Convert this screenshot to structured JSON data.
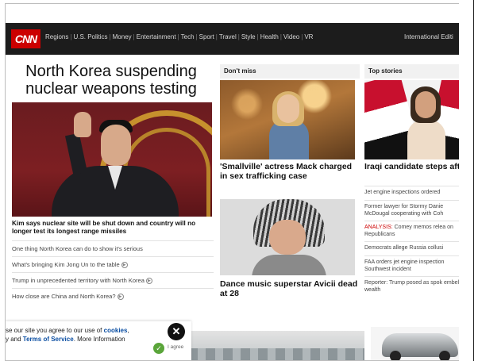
{
  "nav": {
    "logo": "CNN",
    "links": [
      "Regions",
      "U.S. Politics",
      "Money",
      "Entertainment",
      "Tech",
      "Sport",
      "Travel",
      "Style",
      "Health",
      "Video",
      "VR"
    ],
    "edition": "International Editi"
  },
  "lead": {
    "headline": "North Korea suspending nuclear weapons testing",
    "caption": "Kim says nuclear site will be shut down and country will no longer test its longest range missiles",
    "related": [
      {
        "text": "One thing North Korea can do to show it's serious",
        "video": false
      },
      {
        "text": "What's bringing Kim Jong Un to the table",
        "video": true
      },
      {
        "text": "Trump in unprecedented territory with North Korea",
        "video": true
      },
      {
        "text": "How close are China and North Korea?",
        "video": true
      }
    ]
  },
  "dont_miss": {
    "label": "Don't miss",
    "story1": "'Smallville' actress Mack charged in sex trafficking case",
    "story2": "Dance music superstar Avicii dead at 28"
  },
  "top_stories": {
    "label": "Top stories",
    "lead_title": "Iraqi candidate steps after sex tape allegati",
    "items": [
      {
        "prefix": "",
        "text": "Jet engine inspections ordered"
      },
      {
        "prefix": "",
        "text": "Former lawyer for Stormy Danie McDougal cooperating with Coh"
      },
      {
        "prefix": "ANALYSIS:",
        "text": " Comey memos relea on Republicans"
      },
      {
        "prefix": "",
        "text": "Democrats allege Russia collusi"
      },
      {
        "prefix": "",
        "text": "FAA orders jet engine inspection Southwest incident"
      },
      {
        "prefix": "",
        "text": "Reporter: Trump posed as spok embellish wealth"
      }
    ]
  },
  "cookie": {
    "line1_prefix": "se our site you agree to our use of ",
    "cookies_link": "cookies",
    "line1_suffix": ",",
    "line2_prefix": "y and ",
    "terms_link": "Terms of Service",
    "line2_suffix": ". More Information",
    "close": "✕",
    "agree_label": "I agree"
  },
  "colors": {
    "brand_red": "#cc0000",
    "nav_bg": "#1c1c1c",
    "link_blue": "#0b4ea2",
    "agree_green": "#5aa53a"
  }
}
